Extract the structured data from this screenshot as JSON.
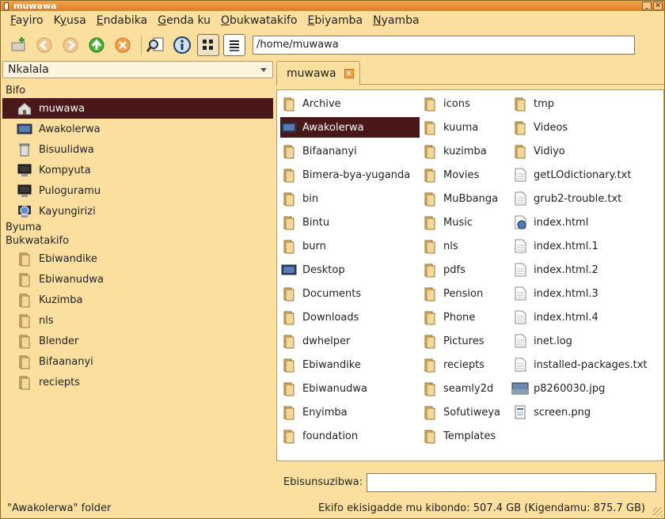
{
  "window": {
    "title": "muwawa"
  },
  "menu": [
    "Fayiro",
    "Kyusa",
    "Endabika",
    "Genda ku",
    "Obukwatakifo",
    "Ebiyamba",
    "Nyamba"
  ],
  "menu_underline_index": [
    0,
    1,
    0,
    0,
    0,
    0,
    0
  ],
  "location": {
    "path": "/home/muwawa"
  },
  "sidebar": {
    "dropdown": "Nkalala",
    "sections": [
      "Bifo",
      "Byuma",
      "Bukwatakifo"
    ],
    "places": [
      {
        "label": "muwawa",
        "icon": "home-icon"
      },
      {
        "label": "Awakolerwa",
        "icon": "desktop-icon"
      },
      {
        "label": "Bisuulidwa",
        "icon": "trash-icon"
      },
      {
        "label": "Kompyuta",
        "icon": "computer-icon"
      },
      {
        "label": "Puloguramu",
        "icon": "computer-icon"
      },
      {
        "label": "Kayungirizi",
        "icon": "network-icon"
      }
    ],
    "bookmarks": [
      "Ebiwandike",
      "Ebiwanudwa",
      "Kuzimba",
      "nls",
      "Blender",
      "Bifaananyi",
      "reciepts"
    ]
  },
  "tab": {
    "label": "muwawa"
  },
  "files": {
    "col1": [
      {
        "name": "Archive",
        "type": "folder"
      },
      {
        "name": "Awakolerwa",
        "type": "desktop"
      },
      {
        "name": "Bifaananyi",
        "type": "folder"
      },
      {
        "name": "Bimera-bya-yuganda",
        "type": "folder"
      },
      {
        "name": "bin",
        "type": "folder"
      },
      {
        "name": "Bintu",
        "type": "folder"
      },
      {
        "name": "burn",
        "type": "folder"
      },
      {
        "name": "Desktop",
        "type": "desktop"
      },
      {
        "name": "Documents",
        "type": "folder"
      },
      {
        "name": "Downloads",
        "type": "folder"
      },
      {
        "name": "dwhelper",
        "type": "folder"
      },
      {
        "name": "Ebiwandike",
        "type": "folder"
      },
      {
        "name": "Ebiwanudwa",
        "type": "folder"
      },
      {
        "name": "Enyimba",
        "type": "folder"
      },
      {
        "name": "foundation",
        "type": "folder"
      }
    ],
    "col2": [
      {
        "name": "icons",
        "type": "folder"
      },
      {
        "name": "kuuma",
        "type": "folder"
      },
      {
        "name": "kuzimba",
        "type": "folder"
      },
      {
        "name": "Movies",
        "type": "folder"
      },
      {
        "name": "MuBbanga",
        "type": "folder"
      },
      {
        "name": "Music",
        "type": "folder"
      },
      {
        "name": "nls",
        "type": "folder"
      },
      {
        "name": "pdfs",
        "type": "folder"
      },
      {
        "name": "Pension",
        "type": "folder"
      },
      {
        "name": "Phone",
        "type": "folder"
      },
      {
        "name": "Pictures",
        "type": "folder"
      },
      {
        "name": "reciepts",
        "type": "folder"
      },
      {
        "name": "seamly2d",
        "type": "folder"
      },
      {
        "name": "Sofutiweya",
        "type": "folder"
      },
      {
        "name": "Templates",
        "type": "folder"
      }
    ],
    "col3": [
      {
        "name": "tmp",
        "type": "folder"
      },
      {
        "name": "Videos",
        "type": "folder"
      },
      {
        "name": "Vidiyo",
        "type": "folder"
      },
      {
        "name": "getLOdictionary.txt",
        "type": "text"
      },
      {
        "name": "grub2-trouble.txt",
        "type": "text"
      },
      {
        "name": "index.html",
        "type": "html"
      },
      {
        "name": "index.html.1",
        "type": "text"
      },
      {
        "name": "index.html.2",
        "type": "text"
      },
      {
        "name": "index.html.3",
        "type": "text"
      },
      {
        "name": "index.html.4",
        "type": "text"
      },
      {
        "name": "inet.log",
        "type": "text"
      },
      {
        "name": "installed-packages.txt",
        "type": "text"
      },
      {
        "name": "p8260030.jpg",
        "type": "image"
      },
      {
        "name": "screen.png",
        "type": "screenshot"
      }
    ]
  },
  "filter": {
    "label": "Ebisunsuzibwa:",
    "value": ""
  },
  "status": {
    "left": "\"Awakolerwa\" folder",
    "right": "Ekifo ekisigadde mu kibondo: 507.4 GB (Kigendamu: 875.7 GB)"
  },
  "colors": {
    "selection": "#4a1818",
    "background": "#fbdf9f",
    "accent": "#f0a24a"
  }
}
